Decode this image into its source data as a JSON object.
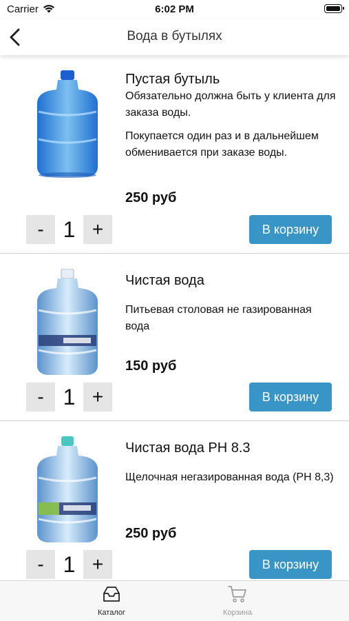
{
  "status_bar": {
    "carrier": "Carrier",
    "time": "6:02 PM"
  },
  "nav": {
    "title": "Вода в бутылях"
  },
  "products": [
    {
      "name": "Пустая бутыль",
      "description": [
        "Обязательно должна быть у клиента для заказа воды.",
        "Покупается один раз и в дальнейшем обменивается при заказе воды."
      ],
      "price": "250 руб",
      "quantity": "1",
      "minus_label": "-",
      "plus_label": "+",
      "cart_label": "В корзину"
    },
    {
      "name": "Чистая вода",
      "description": [
        "Питьевая столовая не газированная вода"
      ],
      "price": "150 руб",
      "quantity": "1",
      "minus_label": "-",
      "plus_label": "+",
      "cart_label": "В корзину"
    },
    {
      "name": "Чистая вода PH 8.3",
      "description": [
        "Щелочная негазированная вода (PH 8,3)"
      ],
      "price": "250 руб",
      "quantity": "1",
      "minus_label": "-",
      "plus_label": "+",
      "cart_label": "В корзину"
    }
  ],
  "tab_bar": {
    "tabs": [
      {
        "label": "Каталог",
        "icon": "inbox-icon",
        "active": true
      },
      {
        "label": "Корзина",
        "icon": "cart-icon",
        "active": false
      }
    ]
  },
  "colors": {
    "accent": "#3895c6",
    "stepper_bg": "#e5e5e5",
    "tab_active": "#222222",
    "tab_inactive": "#9a9a9a"
  }
}
